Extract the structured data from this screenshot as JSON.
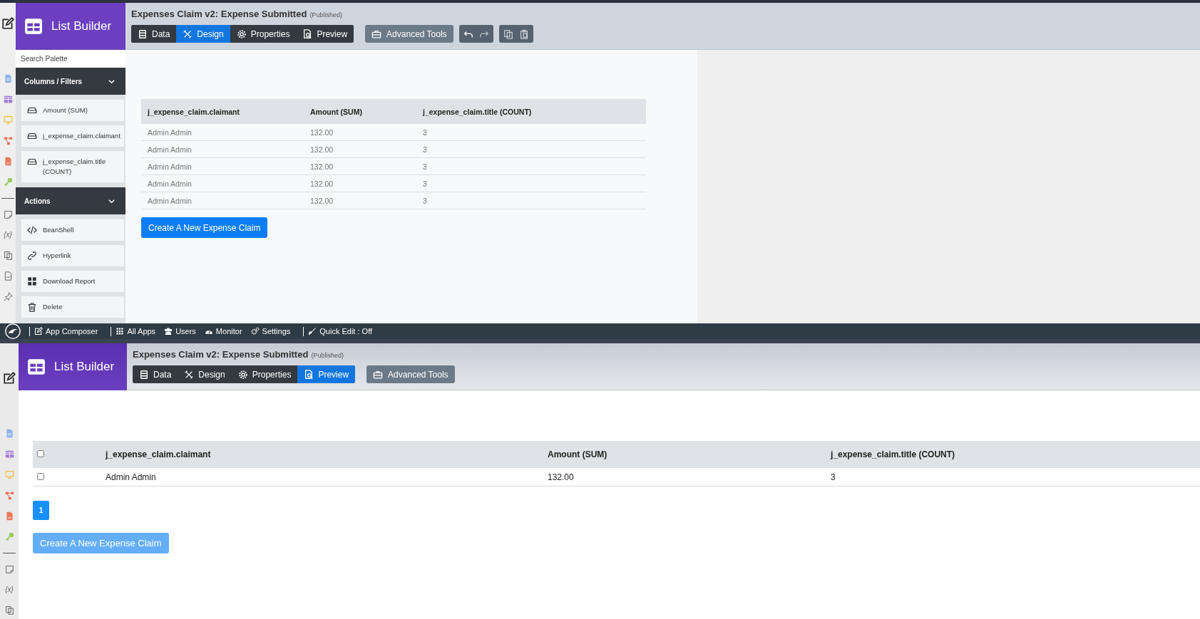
{
  "top_editor": {
    "app_title": "List Builder",
    "form_title": "Expenses Claim v2: Expense Submitted",
    "status": "(Published)",
    "tabs": [
      {
        "label": "Data",
        "kind": "data",
        "selected": false
      },
      {
        "label": "Design",
        "kind": "design",
        "selected": true
      },
      {
        "label": "Properties",
        "kind": "properties",
        "selected": false
      },
      {
        "label": "Preview",
        "kind": "preview",
        "selected": false
      }
    ],
    "advanced_tools": "Advanced Tools",
    "side_glyph": "{x}",
    "palette": {
      "search_placeholder": "Search Palette",
      "sections": [
        {
          "title": "Columns / Filters",
          "items": [
            {
              "label": "Amount (SUM)",
              "kind": "column"
            },
            {
              "label": "j_expense_claim.claimant",
              "kind": "column"
            },
            {
              "label": "j_expense_claim.title (COUNT)",
              "kind": "column"
            }
          ]
        },
        {
          "title": "Actions",
          "items": [
            {
              "label": "BeanShell",
              "kind": "code"
            },
            {
              "label": "Hyperlink",
              "kind": "link"
            },
            {
              "label": "Download Report",
              "kind": "report"
            },
            {
              "label": "Delete",
              "kind": "delete"
            }
          ]
        }
      ]
    },
    "table": {
      "columns": [
        "j_expense_claim.claimant",
        "Amount (SUM)",
        "j_expense_claim.title (COUNT)"
      ],
      "rows": [
        [
          "Admin Admin",
          "132.00",
          "3"
        ],
        [
          "Admin Admin",
          "132.00",
          "3"
        ],
        [
          "Admin Admin",
          "132.00",
          "3"
        ],
        [
          "Admin Admin",
          "132.00",
          "3"
        ],
        [
          "Admin Admin",
          "132.00",
          "3"
        ]
      ]
    },
    "button": {
      "label": "Create A New Expense Claim",
      "disabled": false
    }
  },
  "bottom_bar": {
    "items": [
      {
        "label": "App Composer",
        "kind": "composer"
      },
      {
        "label": "All Apps",
        "kind": "apps"
      },
      {
        "label": "Users",
        "kind": "users"
      },
      {
        "label": "Monitor",
        "kind": "monitor"
      },
      {
        "label": "Settings",
        "kind": "settings"
      },
      {
        "label": "Quick Edit : Off",
        "kind": "quickedit"
      }
    ]
  },
  "bottom_editor": {
    "app_title": "List Builder",
    "form_title": "Expenses Claim v2: Expense Submitted",
    "status": "(Published)",
    "tabs": [
      {
        "label": "Data",
        "kind": "data",
        "selected": false
      },
      {
        "label": "Design",
        "kind": "design",
        "selected": false
      },
      {
        "label": "Properties",
        "kind": "properties",
        "selected": false
      },
      {
        "label": "Preview",
        "kind": "preview",
        "selected": true
      }
    ],
    "advanced_tools": "Advanced Tools",
    "side_glyph": "{x}",
    "table": {
      "select_all_checked": false,
      "columns": [
        "j_expense_claim.claimant",
        "Amount (SUM)",
        "j_expense_claim.title (COUNT)"
      ],
      "rows": [
        {
          "checked": false,
          "cells": [
            "Admin Admin",
            "132.00",
            "3"
          ]
        }
      ]
    },
    "pages": [
      {
        "label": "1",
        "selected": true
      }
    ],
    "button": {
      "label": "Create A New Expense Claim",
      "disabled": true
    }
  }
}
